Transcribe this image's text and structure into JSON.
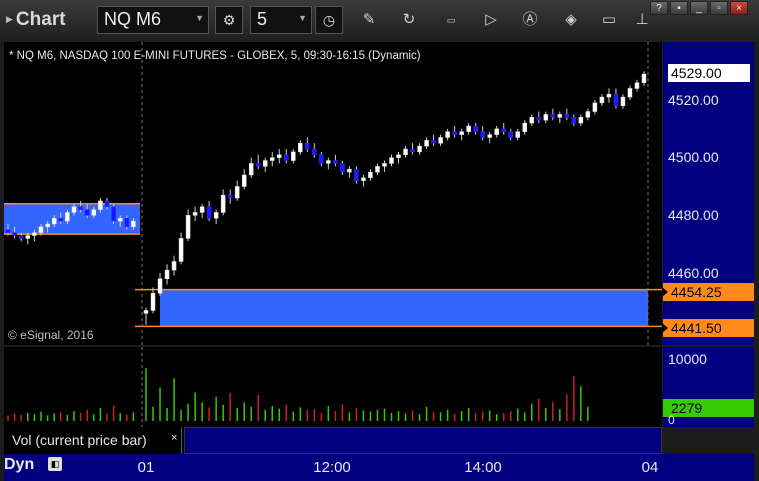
{
  "app": {
    "title": "Chart"
  },
  "toolbar": {
    "symbol": "NQ M6",
    "interval": "5"
  },
  "chart": {
    "header": "* NQ M6, NASDAQ 100 E-MINI FUTURES - GLOBEX, 5, 09:30-16:15 (Dynamic)",
    "watermark": "© eSignal, 2016",
    "price_labels": [
      "4520.00",
      "4500.00",
      "4480.00",
      "4460.00"
    ],
    "current_price": "4529.00",
    "level_high": "4454.25",
    "level_low": "4441.50"
  },
  "volume": {
    "label": "Vol (current price bar)",
    "close_glyph": "×",
    "axis_max": "10000",
    "axis_zero": "0",
    "current_volume": "2279"
  },
  "time_axis": {
    "mode": "Dyn",
    "labels": [
      "01",
      "12:00",
      "14:00",
      "04"
    ]
  },
  "colors": {
    "zone_fill": "#3366ff",
    "zone_border": "#ff8a1a",
    "up_candle": "#ffffff",
    "down_candle": "#1a1aff",
    "vol_up": "#33cc00",
    "vol_down": "#cc2222"
  },
  "icons": [
    "chart-caret-icon",
    "settings-gear-icon",
    "clock-icon",
    "pencil-icon",
    "refresh-icon",
    "get-icon",
    "play-icon",
    "text-a-icon",
    "diamond-tool-icon",
    "chat-icon",
    "pin-icon",
    "lock-icon"
  ],
  "chart_data": {
    "type": "candlestick",
    "ylim": [
      4436,
      4535
    ],
    "series_ohlc": [
      [
        4475,
        4477,
        4473,
        4474
      ],
      [
        4474,
        4476,
        4472,
        4473
      ],
      [
        4473,
        4474,
        4471,
        4472
      ],
      [
        4472,
        4474,
        4470,
        4473
      ],
      [
        4473,
        4475,
        4471,
        4474
      ],
      [
        4474,
        4477,
        4473,
        4476
      ],
      [
        4476,
        4478,
        4474,
        4477
      ],
      [
        4477,
        4480,
        4476,
        4479
      ],
      [
        4479,
        4481,
        4477,
        4478
      ],
      [
        4478,
        4482,
        4477,
        4481
      ],
      [
        4481,
        4484,
        4480,
        4483
      ],
      [
        4483,
        4485,
        4481,
        4482
      ],
      [
        4482,
        4484,
        4479,
        4480
      ],
      [
        4480,
        4483,
        4479,
        4482
      ],
      [
        4482,
        4486,
        4481,
        4485
      ],
      [
        4485,
        4486,
        4482,
        4483
      ],
      [
        4483,
        4484,
        4477,
        4478
      ],
      [
        4478,
        4480,
        4476,
        4479
      ],
      [
        4479,
        4480,
        4475,
        4476
      ],
      [
        4476,
        4479,
        4475,
        4478
      ],
      [
        4446,
        4448,
        4442,
        4447
      ],
      [
        4447,
        4455,
        4446,
        4453
      ],
      [
        4453,
        4460,
        4452,
        4458
      ],
      [
        4458,
        4463,
        4456,
        4461
      ],
      [
        4461,
        4466,
        4459,
        4464
      ],
      [
        4464,
        4474,
        4463,
        4472
      ],
      [
        4472,
        4482,
        4471,
        4480
      ],
      [
        4480,
        4483,
        4478,
        4481
      ],
      [
        4481,
        4484,
        4479,
        4483
      ],
      [
        4483,
        4485,
        4478,
        4479
      ],
      [
        4479,
        4482,
        4477,
        4481
      ],
      [
        4481,
        4489,
        4480,
        4487
      ],
      [
        4487,
        4489,
        4484,
        4486
      ],
      [
        4486,
        4492,
        4485,
        4490
      ],
      [
        4490,
        4496,
        4489,
        4494
      ],
      [
        4494,
        4500,
        4493,
        4498
      ],
      [
        4498,
        4501,
        4496,
        4497
      ],
      [
        4497,
        4500,
        4495,
        4499
      ],
      [
        4499,
        4502,
        4497,
        4500
      ],
      [
        4500,
        4503,
        4498,
        4501
      ],
      [
        4501,
        4503,
        4498,
        4499
      ],
      [
        4499,
        4503,
        4498,
        4502
      ],
      [
        4502,
        4506,
        4501,
        4505
      ],
      [
        4505,
        4507,
        4502,
        4503
      ],
      [
        4503,
        4505,
        4500,
        4501
      ],
      [
        4501,
        4502,
        4497,
        4498
      ],
      [
        4498,
        4500,
        4496,
        4499
      ],
      [
        4499,
        4501,
        4497,
        4498
      ],
      [
        4498,
        4499,
        4494,
        4495
      ],
      [
        4495,
        4497,
        4493,
        4496
      ],
      [
        4496,
        4497,
        4491,
        4492
      ],
      [
        4492,
        4494,
        4490,
        4493
      ],
      [
        4493,
        4496,
        4492,
        4495
      ],
      [
        4495,
        4498,
        4494,
        4497
      ],
      [
        4497,
        4499,
        4495,
        4498
      ],
      [
        4498,
        4501,
        4497,
        4500
      ],
      [
        4500,
        4502,
        4498,
        4501
      ],
      [
        4501,
        4504,
        4500,
        4503
      ],
      [
        4503,
        4505,
        4501,
        4502
      ],
      [
        4502,
        4505,
        4501,
        4504
      ],
      [
        4504,
        4507,
        4503,
        4506
      ],
      [
        4506,
        4508,
        4504,
        4505
      ],
      [
        4505,
        4508,
        4504,
        4507
      ],
      [
        4507,
        4510,
        4506,
        4509
      ],
      [
        4509,
        4511,
        4507,
        4508
      ],
      [
        4508,
        4510,
        4506,
        4509
      ],
      [
        4509,
        4512,
        4508,
        4511
      ],
      [
        4511,
        4512,
        4508,
        4509
      ],
      [
        4509,
        4511,
        4506,
        4507
      ],
      [
        4507,
        4509,
        4505,
        4508
      ],
      [
        4508,
        4511,
        4507,
        4510
      ],
      [
        4510,
        4512,
        4508,
        4509
      ],
      [
        4509,
        4510,
        4506,
        4507
      ],
      [
        4507,
        4510,
        4506,
        4509
      ],
      [
        4509,
        4513,
        4508,
        4512
      ],
      [
        4512,
        4515,
        4511,
        4514
      ],
      [
        4514,
        4516,
        4512,
        4513
      ],
      [
        4513,
        4516,
        4512,
        4515
      ],
      [
        4515,
        4517,
        4513,
        4514
      ],
      [
        4514,
        4516,
        4512,
        4515
      ],
      [
        4515,
        4517,
        4513,
        4514
      ],
      [
        4514,
        4515,
        4511,
        4512
      ],
      [
        4512,
        4515,
        4511,
        4514
      ],
      [
        4514,
        4517,
        4513,
        4516
      ],
      [
        4516,
        4520,
        4515,
        4519
      ],
      [
        4519,
        4522,
        4518,
        4521
      ],
      [
        4521,
        4524,
        4519,
        4522
      ],
      [
        4522,
        4524,
        4517,
        4518
      ],
      [
        4518,
        4522,
        4517,
        4521
      ],
      [
        4521,
        4525,
        4520,
        4524
      ],
      [
        4524,
        4527,
        4523,
        4526
      ],
      [
        4526,
        4530,
        4525,
        4529
      ]
    ],
    "volume": [
      900,
      1200,
      1000,
      1300,
      1100,
      1500,
      900,
      1200,
      1400,
      1000,
      1600,
      1300,
      1800,
      1100,
      2100,
      1200,
      2500,
      1300,
      1000,
      1400,
      8500,
      2300,
      5400,
      2100,
      6900,
      1800,
      2800,
      4600,
      3000,
      2200,
      3900,
      2600,
      4500,
      2100,
      3000,
      2300,
      4200,
      1800,
      2400,
      2000,
      2600,
      1500,
      2200,
      1800,
      1900,
      1300,
      2400,
      1600,
      2700,
      1400,
      2100,
      1700,
      1500,
      1800,
      2000,
      1300,
      1600,
      1200,
      1700,
      1100,
      2300,
      1500,
      1400,
      1800,
      1200,
      1600,
      2100,
      1300,
      1500,
      1700,
      1100,
      1300,
      1600,
      2000,
      1400,
      2800,
      3600,
      2100,
      3100,
      1900,
      4300,
      7200,
      5600,
      2279
    ]
  }
}
